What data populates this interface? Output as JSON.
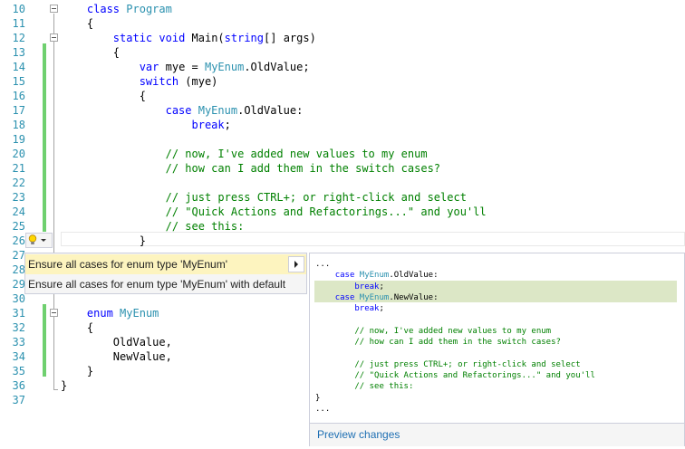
{
  "editor": {
    "lines": [
      {
        "n": "10",
        "code": [
          {
            "t": "    "
          },
          {
            "t": "class",
            "c": "kw"
          },
          {
            "t": " "
          },
          {
            "t": "Program",
            "c": "ty"
          }
        ]
      },
      {
        "n": "11",
        "code": [
          {
            "t": "    {"
          }
        ]
      },
      {
        "n": "12",
        "code": [
          {
            "t": "        "
          },
          {
            "t": "static",
            "c": "kw"
          },
          {
            "t": " "
          },
          {
            "t": "void",
            "c": "kw"
          },
          {
            "t": " Main("
          },
          {
            "t": "string",
            "c": "kw"
          },
          {
            "t": "[] args)"
          }
        ]
      },
      {
        "n": "13",
        "code": [
          {
            "t": "        {"
          }
        ]
      },
      {
        "n": "14",
        "code": [
          {
            "t": "            "
          },
          {
            "t": "var",
            "c": "kw"
          },
          {
            "t": " mye = "
          },
          {
            "t": "MyEnum",
            "c": "ty"
          },
          {
            "t": ".OldValue;"
          }
        ]
      },
      {
        "n": "15",
        "code": [
          {
            "t": "            "
          },
          {
            "t": "switch",
            "c": "kw"
          },
          {
            "t": " (mye)"
          }
        ]
      },
      {
        "n": "16",
        "code": [
          {
            "t": "            {"
          }
        ]
      },
      {
        "n": "17",
        "code": [
          {
            "t": "                "
          },
          {
            "t": "case",
            "c": "kw"
          },
          {
            "t": " "
          },
          {
            "t": "MyEnum",
            "c": "ty"
          },
          {
            "t": ".OldValue:"
          }
        ]
      },
      {
        "n": "18",
        "code": [
          {
            "t": "                    "
          },
          {
            "t": "break",
            "c": "kw"
          },
          {
            "t": ";"
          }
        ]
      },
      {
        "n": "19",
        "code": []
      },
      {
        "n": "20",
        "code": [
          {
            "t": "                "
          },
          {
            "t": "// now, I've added new values to my enum",
            "c": "cm"
          }
        ]
      },
      {
        "n": "21",
        "code": [
          {
            "t": "                "
          },
          {
            "t": "// how can I add them in the switch cases?",
            "c": "cm"
          }
        ]
      },
      {
        "n": "22",
        "code": []
      },
      {
        "n": "23",
        "code": [
          {
            "t": "                "
          },
          {
            "t": "// just press CTRL+; or right-click and select",
            "c": "cm"
          }
        ]
      },
      {
        "n": "24",
        "code": [
          {
            "t": "                "
          },
          {
            "t": "// \"Quick Actions and Refactorings...\" and you'll",
            "c": "cm"
          }
        ]
      },
      {
        "n": "25",
        "code": [
          {
            "t": "                "
          },
          {
            "t": "// see this:",
            "c": "cm"
          }
        ]
      },
      {
        "n": "26",
        "code": [
          {
            "t": "            }"
          }
        ]
      },
      {
        "n": "27",
        "code": []
      },
      {
        "n": "28",
        "code": []
      },
      {
        "n": "29",
        "code": []
      },
      {
        "n": "30",
        "code": []
      },
      {
        "n": "31",
        "code": [
          {
            "t": "    "
          },
          {
            "t": "enum",
            "c": "kw"
          },
          {
            "t": " "
          },
          {
            "t": "MyEnum",
            "c": "ty"
          }
        ]
      },
      {
        "n": "32",
        "code": [
          {
            "t": "    {"
          }
        ]
      },
      {
        "n": "33",
        "code": [
          {
            "t": "        OldValue,"
          }
        ]
      },
      {
        "n": "34",
        "code": [
          {
            "t": "        NewValue,"
          }
        ]
      },
      {
        "n": "35",
        "code": [
          {
            "t": "    }"
          }
        ]
      },
      {
        "n": "36",
        "code": [
          {
            "t": "}"
          }
        ]
      },
      {
        "n": "37",
        "code": []
      }
    ]
  },
  "quick_actions": {
    "items": [
      {
        "label": "Ensure all cases for enum type 'MyEnum'"
      },
      {
        "label": "Ensure all cases for enum type 'MyEnum' with default"
      }
    ]
  },
  "preview": {
    "lines": [
      {
        "code": [
          {
            "t": "..."
          }
        ]
      },
      {
        "code": [
          {
            "t": "    "
          },
          {
            "t": "case",
            "c": "kw"
          },
          {
            "t": " "
          },
          {
            "t": "MyEnum",
            "c": "ty"
          },
          {
            "t": ".OldValue:"
          }
        ]
      },
      {
        "code": [
          {
            "t": "        "
          },
          {
            "t": "break",
            "c": "kw"
          },
          {
            "t": ";"
          }
        ]
      },
      {
        "code": [
          {
            "t": "    "
          },
          {
            "t": "case",
            "c": "kw"
          },
          {
            "t": " "
          },
          {
            "t": "MyEnum",
            "c": "ty"
          },
          {
            "t": ".NewValue:"
          }
        ]
      },
      {
        "code": [
          {
            "t": "        "
          },
          {
            "t": "break",
            "c": "kw"
          },
          {
            "t": ";"
          }
        ]
      },
      {
        "code": []
      },
      {
        "code": [
          {
            "t": "        "
          },
          {
            "t": "// now, I've added new values to my enum",
            "c": "cm"
          }
        ]
      },
      {
        "code": [
          {
            "t": "        "
          },
          {
            "t": "// how can I add them in the switch cases?",
            "c": "cm"
          }
        ]
      },
      {
        "code": []
      },
      {
        "code": [
          {
            "t": "        "
          },
          {
            "t": "// just press CTRL+; or right-click and select",
            "c": "cm"
          }
        ]
      },
      {
        "code": [
          {
            "t": "        "
          },
          {
            "t": "// \"Quick Actions and Refactorings...\" and you'll",
            "c": "cm"
          }
        ]
      },
      {
        "code": [
          {
            "t": "        "
          },
          {
            "t": "// see this:",
            "c": "cm"
          }
        ]
      },
      {
        "code": [
          {
            "t": "}"
          }
        ]
      },
      {
        "code": [
          {
            "t": "..."
          }
        ]
      }
    ],
    "footer_label": "Preview changes"
  },
  "colors": {
    "keyword": "#0000ff",
    "type": "#2b91af",
    "comment": "#008000",
    "added_line": "#dce7c6",
    "selected_item": "#fdf4bf",
    "change_bar": "#6fd06f"
  },
  "icons": {
    "lightbulb": "lightbulb-icon",
    "dropdown": "chevron-down-icon",
    "submenu": "chevron-right-icon"
  }
}
